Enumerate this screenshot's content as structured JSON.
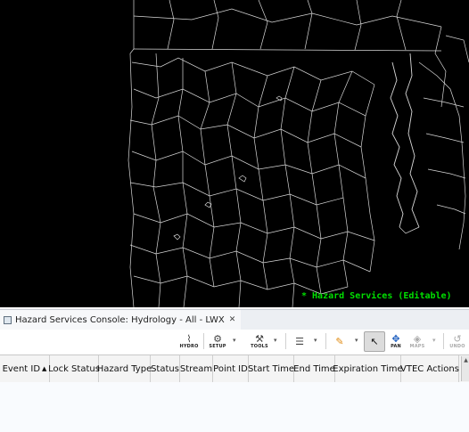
{
  "map": {
    "status_text": "* Hazard Services (Editable)"
  },
  "console": {
    "tab_title": "Hazard Services Console: Hydrology - All - LWX",
    "close_glyph": "✕"
  },
  "toolbar": {
    "hydro_label": "HYDRO",
    "setup_label": "SETUP",
    "tools_label": "TOOLS",
    "pan_label": "PAN",
    "maps_label": "MAPS",
    "undo_label": "UNDO"
  },
  "table": {
    "columns": [
      "Event ID",
      "Lock Status",
      "Hazard Type",
      "Status",
      "Stream",
      "Point ID",
      "Start Time",
      "End Time",
      "Expiration Time",
      "VTEC Actions"
    ],
    "sort_indicator": "▲"
  }
}
